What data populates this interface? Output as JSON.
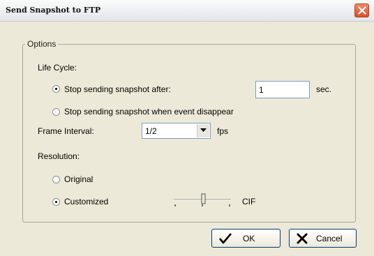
{
  "window": {
    "title": "Send Snapshot to FTP",
    "close_icon": "close-icon"
  },
  "options": {
    "legend": "Options",
    "life_cycle": {
      "label": "Life Cycle:",
      "option_after": "Stop sending snapshot after:",
      "option_after_selected": true,
      "seconds_value": "1",
      "seconds_unit": "sec.",
      "option_disappear": "Stop sending snapshot when event disappear",
      "option_disappear_selected": false
    },
    "frame_interval": {
      "label": "Frame Interval:",
      "value": "1/2",
      "unit": "fps"
    },
    "resolution": {
      "label": "Resolution:",
      "original": "Original",
      "original_selected": false,
      "customized": "Customized",
      "customized_selected": true,
      "slider_value_label": "CIF"
    }
  },
  "buttons": {
    "ok": "OK",
    "cancel": "Cancel"
  },
  "colors": {
    "close_button": "#d9502c",
    "background": "#ece9d8",
    "input_border": "#7f9db9"
  }
}
